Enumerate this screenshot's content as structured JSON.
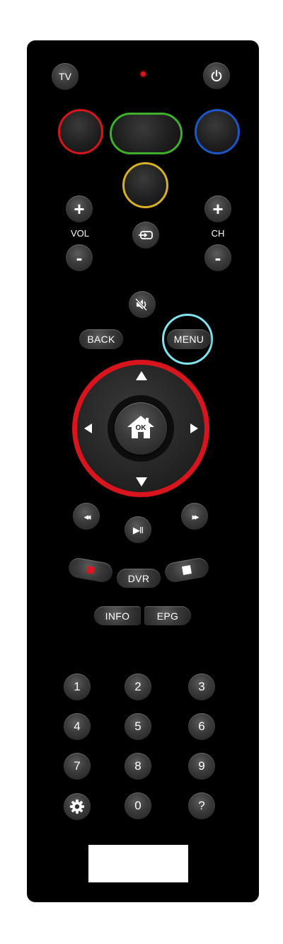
{
  "top": {
    "tv_label": "TV",
    "power_icon": "power-icon",
    "led_color": "#e0141e"
  },
  "colors": {
    "red": "#d8141c",
    "green": "#3fae2a",
    "blue": "#1c55c8",
    "yellow": "#d7b024"
  },
  "volume": {
    "label": "VOL",
    "plus": "+",
    "minus": "-"
  },
  "channel": {
    "label": "CH",
    "plus": "+",
    "minus": "-"
  },
  "source_icon": "input-source-icon",
  "mute_icon": "mute-icon",
  "nav": {
    "back_label": "BACK",
    "menu_label": "MENU",
    "menu_ring_color": "#7fe3f0",
    "dpad_ring_color": "#d8141c",
    "ok_label": "OK"
  },
  "transport": {
    "rewind": "◂◂",
    "play_pause": "▶II",
    "fast_forward": "▸▸"
  },
  "dvr": {
    "record_color": "#e0141e",
    "label": "DVR"
  },
  "info_label": "INFO",
  "epg_label": "EPG",
  "keypad": [
    "1",
    "2",
    "3",
    "4",
    "5",
    "6",
    "7",
    "8",
    "9",
    "0",
    "?"
  ]
}
